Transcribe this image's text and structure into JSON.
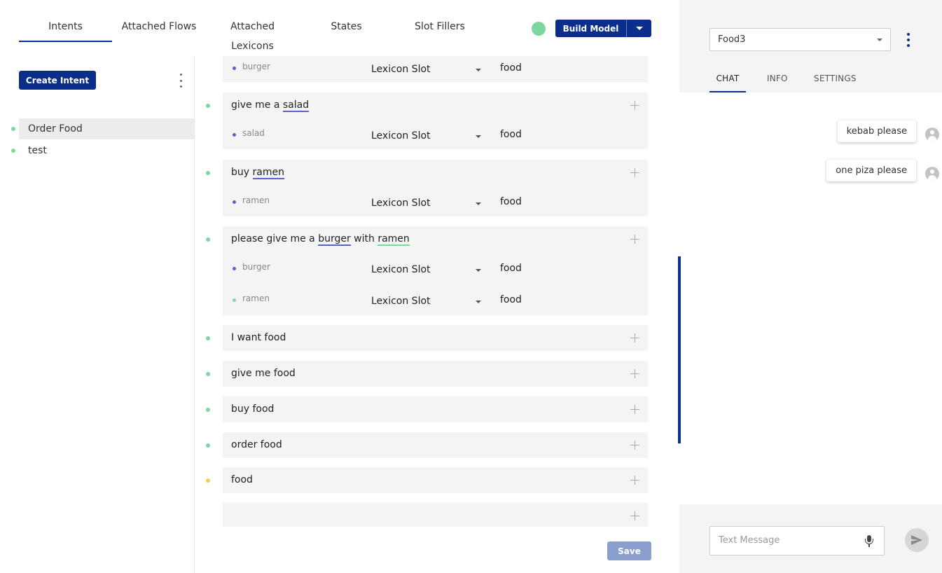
{
  "tabs": [
    "Intents",
    "Attached Flows",
    "Attached Lexicons",
    "States",
    "Slot Fillers"
  ],
  "active_tab": "Intents",
  "build_button": "Build Model",
  "create_intent": "Create Intent",
  "intents": [
    {
      "label": "Order Food",
      "selected": true
    },
    {
      "label": "test",
      "selected": false
    }
  ],
  "examples": {
    "card0": {
      "slot0": {
        "name": "burger",
        "type": "Lexicon Slot",
        "value": "food"
      }
    },
    "card1": {
      "pre": "give me a ",
      "hl": "salad",
      "slot0": {
        "name": "salad",
        "type": "Lexicon Slot",
        "value": "food"
      }
    },
    "card2": {
      "pre": "buy ",
      "hl": "ramen",
      "slot0": {
        "name": "ramen",
        "type": "Lexicon Slot",
        "value": "food"
      }
    },
    "card3": {
      "pre": "please give me a ",
      "hl1": "burger",
      "mid": " with ",
      "hl2": "ramen",
      "slot0": {
        "name": "burger",
        "type": "Lexicon Slot",
        "value": "food"
      },
      "slot1": {
        "name": "ramen",
        "type": "Lexicon Slot",
        "value": "food"
      }
    },
    "card4": {
      "text": "I want food"
    },
    "card5": {
      "text": "give me food"
    },
    "card6": {
      "text": "buy food"
    },
    "card7": {
      "text": "order food"
    },
    "card8": {
      "text": "food"
    },
    "card9": {
      "text": ""
    }
  },
  "save_button": "Save",
  "chat": {
    "model": "Food3",
    "tabs": [
      "CHAT",
      "INFO",
      "SETTINGS"
    ],
    "active_tab": "CHAT",
    "messages": [
      "kebab please",
      "one piza please"
    ],
    "input_placeholder": "Text Message"
  },
  "colors": {
    "primary": "#0b2e8c",
    "status_green": "#7dd8a0",
    "status_yellow": "#f5cc54",
    "highlight_blue": "#5a62c8",
    "highlight_green": "#7dd8a0"
  }
}
